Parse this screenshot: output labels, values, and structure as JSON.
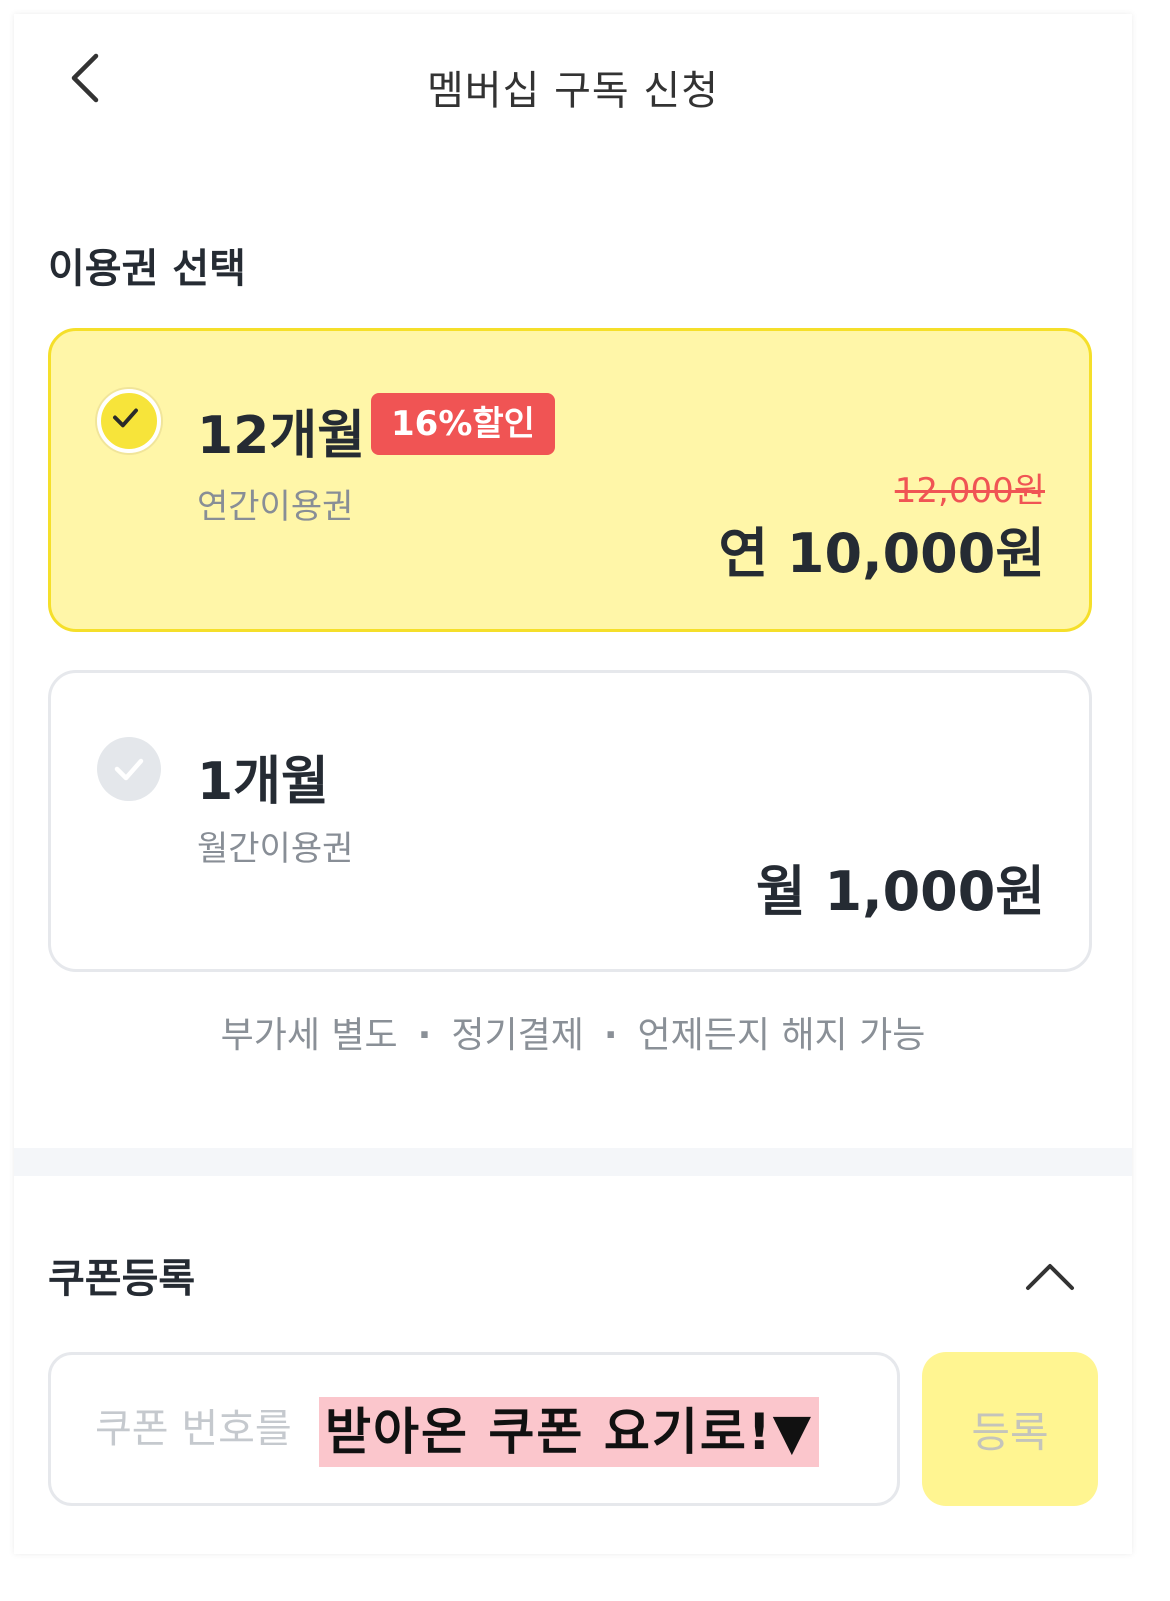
{
  "header": {
    "title": "멤버십 구독 신청",
    "back_icon": "chevron-left-icon"
  },
  "plan_section": {
    "title": "이용권 선택",
    "plans": [
      {
        "name": "12개월",
        "badge": "16%할인",
        "subtitle": "연간이용권",
        "original_price": "12,000원",
        "price": "연 10,000원",
        "selected": true
      },
      {
        "name": "1개월",
        "subtitle": "월간이용권",
        "price": "월 1,000원",
        "selected": false
      }
    ],
    "notes": [
      "부가세 별도",
      "정기결제",
      "언제든지 해지 가능"
    ],
    "note_separator": "·"
  },
  "coupon": {
    "title": "쿠폰등록",
    "collapse_icon": "chevron-up-icon",
    "input_placeholder": "쿠폰 번호를",
    "input_value": "",
    "annotation": "받아온 쿠폰 요기로!▼",
    "register_label": "등록"
  },
  "colors": {
    "selected_bg": "#fff6a8",
    "selected_border": "#f5df2a",
    "check_on": "#f7e43a",
    "badge": "#f05454",
    "strike_price": "#f05454",
    "register_bg": "#fff591",
    "annotation_bg": "#fbc6cc"
  }
}
